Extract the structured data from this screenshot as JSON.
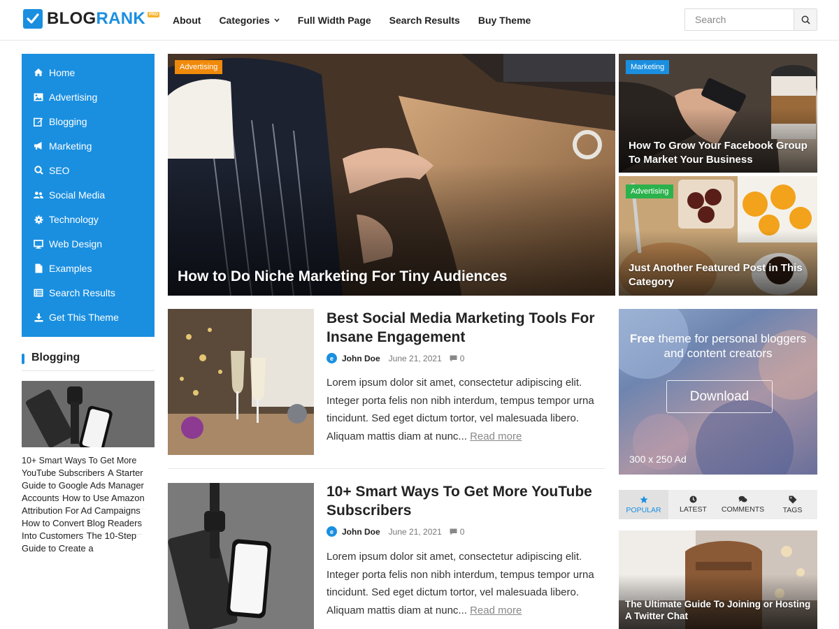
{
  "brand": {
    "name_part1": "BLOG",
    "name_part2": "RANK",
    "tag": "PRO"
  },
  "nav": {
    "items": [
      {
        "label": "About"
      },
      {
        "label": "Categories"
      },
      {
        "label": "Full Width Page"
      },
      {
        "label": "Search Results"
      },
      {
        "label": "Buy Theme"
      }
    ]
  },
  "search": {
    "placeholder": "Search"
  },
  "sidebar": {
    "menu": [
      {
        "label": "Home",
        "icon": "home-icon"
      },
      {
        "label": "Advertising",
        "icon": "image-icon"
      },
      {
        "label": "Blogging",
        "icon": "edit-icon"
      },
      {
        "label": "Marketing",
        "icon": "megaphone-icon"
      },
      {
        "label": "SEO",
        "icon": "search-icon"
      },
      {
        "label": "Social Media",
        "icon": "users-icon"
      },
      {
        "label": "Technology",
        "icon": "gear-icon"
      },
      {
        "label": "Web Design",
        "icon": "desktop-icon"
      },
      {
        "label": "Examples",
        "icon": "file-icon"
      },
      {
        "label": "Search Results",
        "icon": "list-icon"
      },
      {
        "label": "Get This Theme",
        "icon": "download-icon"
      }
    ],
    "widget_title": "Blogging",
    "posts": [
      {
        "title": "10+ Smart Ways To Get More YouTube Subscribers"
      },
      {
        "title": "A Starter Guide to Google Ads Manager Accounts"
      },
      {
        "title": "How to Use Amazon Attribution For Ad Campaigns"
      },
      {
        "title": "How to Convert Blog Readers Into Customers"
      },
      {
        "title": "The 10-Step Guide to Create a"
      }
    ]
  },
  "featured": {
    "main": {
      "category": "Advertising",
      "title": "How to Do Niche Marketing For Tiny Audiences"
    },
    "side1": {
      "category": "Marketing",
      "title": "How To Grow Your Facebook Group To Market Your Business"
    },
    "side2": {
      "category": "Advertising",
      "title": "Just Another Featured Post in This Category"
    }
  },
  "posts": [
    {
      "title": "Best Social Media Marketing Tools For Insane Engagement",
      "author": "John Doe",
      "date": "June 21, 2021",
      "comments": "0",
      "excerpt": "Lorem ipsum dolor sit amet, consectetur adipiscing elit. Integer porta felis non nibh interdum, tempus tempor urna tincidunt. Sed eget dictum tortor, vel malesuada libero. Aliquam mattis diam at nunc...",
      "read_more": "Read more"
    },
    {
      "title": "10+ Smart Ways To Get More YouTube Subscribers",
      "author": "John Doe",
      "date": "June 21, 2021",
      "comments": "0",
      "excerpt": "Lorem ipsum dolor sit amet, consectetur adipiscing elit. Integer porta felis non nibh interdum, tempus tempor urna tincidunt. Sed eget dictum tortor, vel malesuada libero. Aliquam mattis diam at nunc...",
      "read_more": "Read more"
    }
  ],
  "ad": {
    "text_bold": "Free",
    "text_rest": " theme for personal bloggers and content creators",
    "button": "Download",
    "size": "300 x 250 Ad"
  },
  "tabs": {
    "items": [
      {
        "label": "POPULAR",
        "icon": "star-icon"
      },
      {
        "label": "LATEST",
        "icon": "clock-icon"
      },
      {
        "label": "COMMENTS",
        "icon": "comments-icon"
      },
      {
        "label": "TAGS",
        "icon": "tag-icon"
      }
    ],
    "active": "POPULAR",
    "post_title": "The Ultimate Guide To Joining or Hosting A Twitter Chat"
  },
  "colors": {
    "accent": "#1a8fe0",
    "badge_orange": "#f08a0b",
    "badge_green": "#2bb24c"
  }
}
